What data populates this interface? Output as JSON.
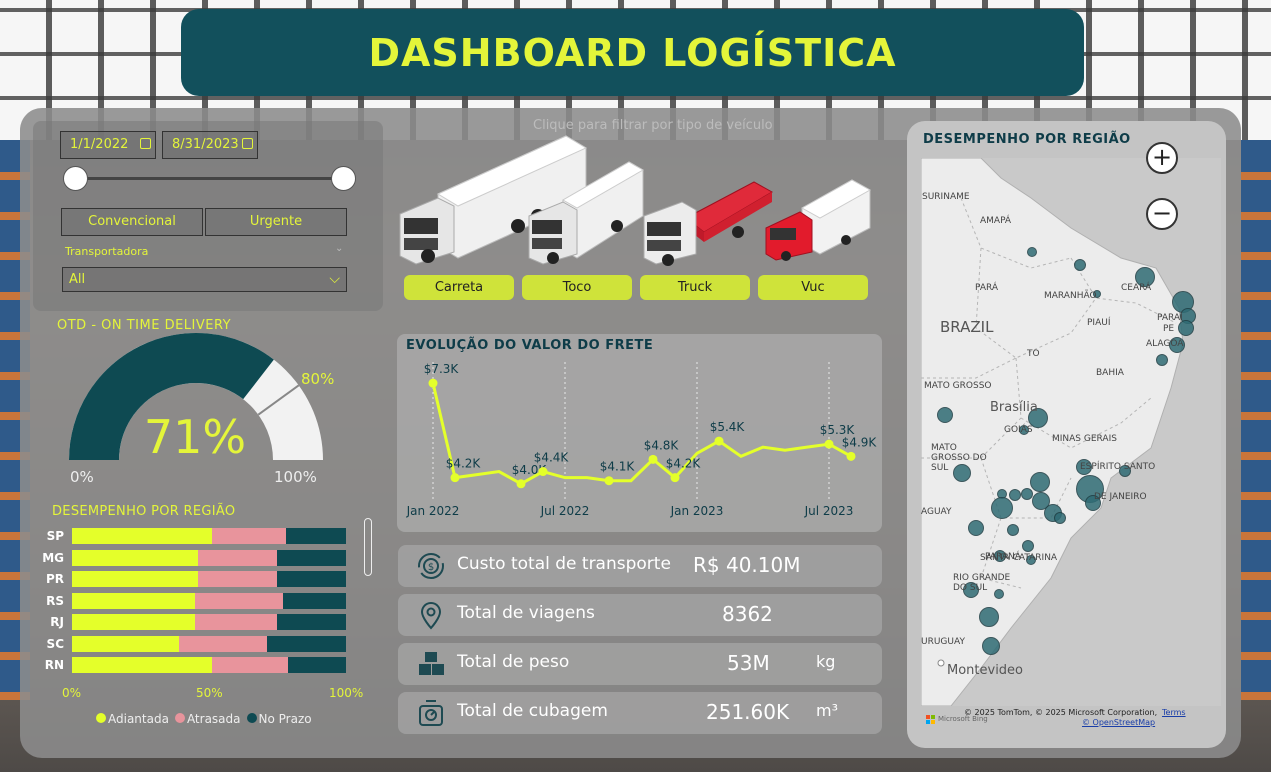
{
  "title": "DASHBOARD LOGÍSTICA",
  "filters": {
    "date_start": "1/1/2022",
    "date_end": "8/31/2023",
    "type_options": [
      "Convencional",
      "Urgente"
    ],
    "carrier_label": "Transportadora",
    "carrier_value": "All"
  },
  "otd": {
    "title": "OTD - ON TIME DELIVERY",
    "value_pct": 71,
    "value_label": "71%",
    "target_pct": 80,
    "target_label": "80%",
    "min_label": "0%",
    "max_label": "100%",
    "colors": {
      "fill": "#0e4a52",
      "track": "#f2f2f2",
      "text": "#e4f53a"
    }
  },
  "region_bars": {
    "title": "DESEMPENHO POR REGIÃO",
    "rows": [
      {
        "state": "SP",
        "adiantada": 51,
        "atrasada": 27,
        "no_prazo": 22
      },
      {
        "state": "MG",
        "adiantada": 46,
        "atrasada": 29,
        "no_prazo": 25
      },
      {
        "state": "PR",
        "adiantada": 46,
        "atrasada": 29,
        "no_prazo": 25
      },
      {
        "state": "RS",
        "adiantada": 45,
        "atrasada": 32,
        "no_prazo": 23
      },
      {
        "state": "RJ",
        "adiantada": 45,
        "atrasada": 30,
        "no_prazo": 25
      },
      {
        "state": "SC",
        "adiantada": 39,
        "atrasada": 32,
        "no_prazo": 29
      },
      {
        "state": "RN",
        "adiantada": 51,
        "atrasada": 28,
        "no_prazo": 21
      }
    ],
    "axis_labels": [
      "0%",
      "50%",
      "100%"
    ],
    "legend": [
      {
        "name": "Adiantada",
        "color": "#e4ff2a"
      },
      {
        "name": "Atrasada",
        "color": "#e8949c"
      },
      {
        "name": "No Prazo",
        "color": "#0e4a52"
      }
    ]
  },
  "vehicles": {
    "caption": "Clique para filtrar por tipo de veículo",
    "buttons": [
      "Carreta",
      "Toco",
      "Truck",
      "Vuc"
    ]
  },
  "chart_data": {
    "type": "line",
    "title": "EVOLUÇÃO DO VALOR DO FRETE",
    "x": [
      "2022-01",
      "2022-02",
      "2022-03",
      "2022-04",
      "2022-05",
      "2022-06",
      "2022-07",
      "2022-08",
      "2022-09",
      "2022-10",
      "2022-11",
      "2022-12",
      "2023-01",
      "2023-02",
      "2023-03",
      "2023-04",
      "2023-05",
      "2023-06",
      "2023-07",
      "2023-08"
    ],
    "series": [
      {
        "values": [
          7.3,
          4.2,
          4.3,
          4.4,
          4.0,
          4.4,
          4.2,
          4.2,
          4.1,
          4.1,
          4.8,
          4.2,
          5.0,
          5.4,
          4.9,
          5.2,
          5.1,
          5.2,
          5.3,
          4.9
        ]
      }
    ],
    "data_labels": [
      {
        "x": "2022-01",
        "text": "$7.3K"
      },
      {
        "x": "2022-02",
        "text": "$4.2K"
      },
      {
        "x": "2022-05",
        "text": "$4.0K"
      },
      {
        "x": "2022-06",
        "text": "$4.4K"
      },
      {
        "x": "2022-09",
        "text": "$4.1K"
      },
      {
        "x": "2022-11",
        "text": "$4.8K"
      },
      {
        "x": "2022-12",
        "text": "$4.2K"
      },
      {
        "x": "2023-02",
        "text": "$5.4K"
      },
      {
        "x": "2023-07",
        "text": "$5.3K"
      },
      {
        "x": "2023-08",
        "text": "$4.9K"
      }
    ],
    "tick_labels": [
      "Jan 2022",
      "Jul 2022",
      "Jan 2023",
      "Jul 2023"
    ],
    "ylim": [
      3.5,
      7.6
    ],
    "line_color": "#e4ff2a",
    "label_color": "#0e3c48"
  },
  "kpis": [
    {
      "icon": "money-cycle-icon",
      "label": "Custo total de transporte",
      "value": "R$ 40.10M",
      "unit": ""
    },
    {
      "icon": "location-pin-icon",
      "label": "Total de viagens",
      "value": "8362",
      "unit": ""
    },
    {
      "icon": "boxes-icon",
      "label": "Total de peso",
      "value": "53M",
      "unit": "kg"
    },
    {
      "icon": "scale-icon",
      "label": "Total de cubagem",
      "value": "251.60K",
      "unit": "m³"
    }
  ],
  "map": {
    "title": "DESEMPENHO POR REGIÃO",
    "zoom_in": "+",
    "zoom_out": "−",
    "labels": [
      "SURINAME",
      "AMAPÁ",
      "PARÁ",
      "MARANHÃO",
      "CEARÁ",
      "BRAZIL",
      "PIAUÍ",
      "PARAÍ",
      "PE",
      "ALAGOA",
      "TO",
      "BAHIA",
      "MATO GROSSO",
      "Brasília",
      "GOIÁS",
      "MINAS GERAIS",
      "MATO GROSSO DO SUL",
      "ESPÍRITO SANTO",
      "DE JANEIRO",
      "PARANÁ",
      "AGUAY",
      "SANTA CATARINA",
      "RIO GRANDE DO SUL",
      "URUGUAY",
      "Montevideo"
    ],
    "attribution": "© 2025 TomTom, © 2025 Microsoft Corporation,",
    "terms": "Terms",
    "osm": "© OpenStreetMap",
    "bing": "Microsoft Bing",
    "bubble_color": "#2f6b74"
  }
}
